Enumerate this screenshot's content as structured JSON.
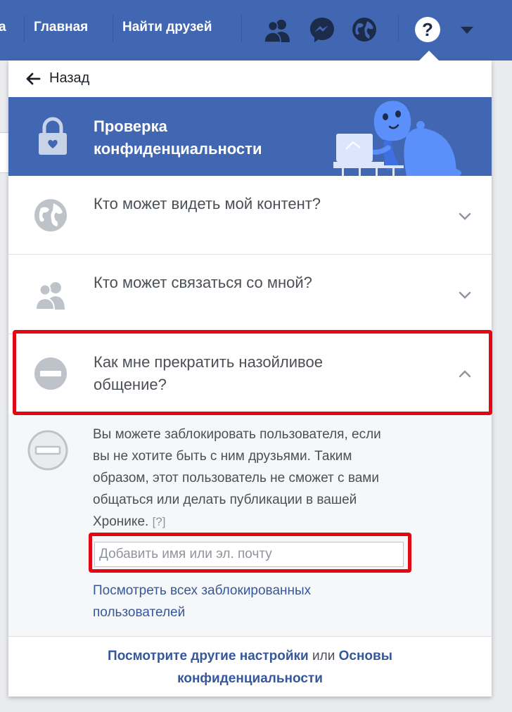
{
  "topbar": {
    "partial_label": "а",
    "home_label": "Главная",
    "find_friends_label": "Найти друзей",
    "icons": [
      "friends-icon",
      "messenger-icon",
      "globe-icon",
      "help-icon",
      "dropdown-arrow-icon"
    ]
  },
  "panel": {
    "back_label": "Назад",
    "hero_title": "Проверка конфиденциальности",
    "questions": [
      {
        "label": "Кто может видеть мой контент?",
        "icon": "globe-icon",
        "state": "collapsed"
      },
      {
        "label": "Кто может связаться со мной?",
        "icon": "people-icon",
        "state": "collapsed"
      },
      {
        "label": "Как мне прекратить назойливое общение?",
        "icon": "block-icon",
        "state": "expanded"
      }
    ],
    "expanded": {
      "description": "Вы можете заблокировать пользователя, если вы не хотите быть с ним друзьями. Таким образом, этот пользователь не сможет с вами общаться или делать публикации в вашей Хронике.",
      "help_marker": "[?]",
      "input_placeholder": "Добавить имя или эл. почту",
      "input_value": "",
      "see_all_blocked_link": "Посмотреть всех заблокированных пользователей"
    },
    "footer": {
      "link_other_settings": "Посмотрите другие настройки",
      "connector": "или",
      "link_privacy_basics": "Основы конфиденциальности"
    }
  },
  "colors": {
    "brand_blue": "#4267b2",
    "link_blue": "#365899",
    "highlight_red": "#e30613",
    "icon_gray": "#bec3c9",
    "dino_blue": "#5b8ff9"
  }
}
